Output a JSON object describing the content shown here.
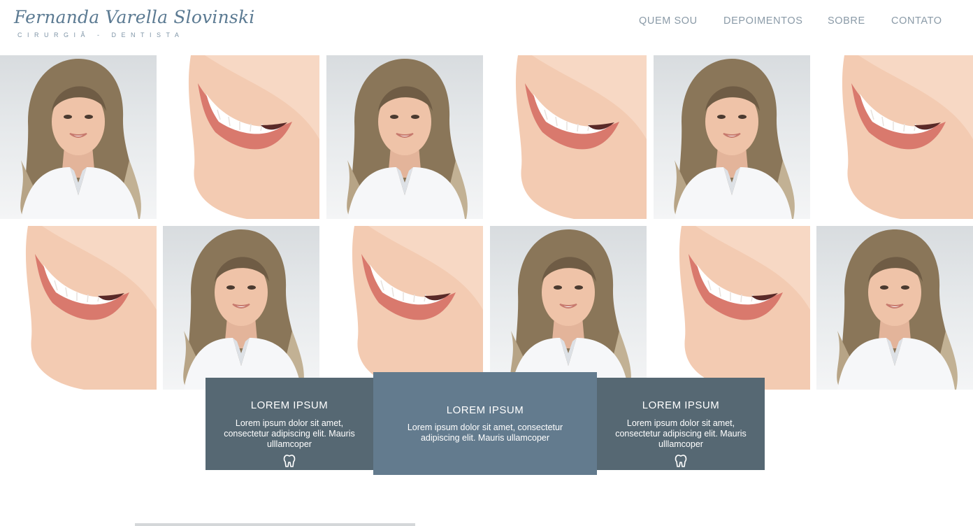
{
  "brand": {
    "name": "Fernanda Varella Slovinski",
    "subtitle": "CIRURGIÃ - DENTISTA"
  },
  "nav": {
    "items": [
      {
        "label": "QUEM SOU"
      },
      {
        "label": "DEPOIMENTOS"
      },
      {
        "label": "SOBRE"
      },
      {
        "label": "CONTATO"
      }
    ]
  },
  "gallery": {
    "rows": [
      [
        "portrait-photo",
        "smile-photo",
        "portrait-photo",
        "smile-photo",
        "portrait-photo",
        "smile-photo"
      ],
      [
        "smile-photo",
        "portrait-photo",
        "smile-photo",
        "portrait-photo",
        "smile-photo",
        "portrait-photo"
      ]
    ]
  },
  "features": [
    {
      "title": "LOREM IPSUM",
      "text": "Lorem ipsum dolor sit amet, consectetur adipiscing elit. Mauris ulllamcoper",
      "icon": "tooth-icon"
    },
    {
      "title": "LOREM IPSUM",
      "text": "Lorem ipsum dolor sit amet, consectetur adipiscing elit. Mauris ullamcoper"
    },
    {
      "title": "LOREM IPSUM",
      "text": "Lorem ipsum dolor sit amet, consectetur adipiscing elit. Mauris ulllamcoper",
      "icon": "tooth-icon"
    }
  ],
  "colors": {
    "brand": "#5b7a92",
    "nav_text": "#8a9aa7",
    "card_side": "#566873",
    "card_mid": "#637b8e"
  }
}
